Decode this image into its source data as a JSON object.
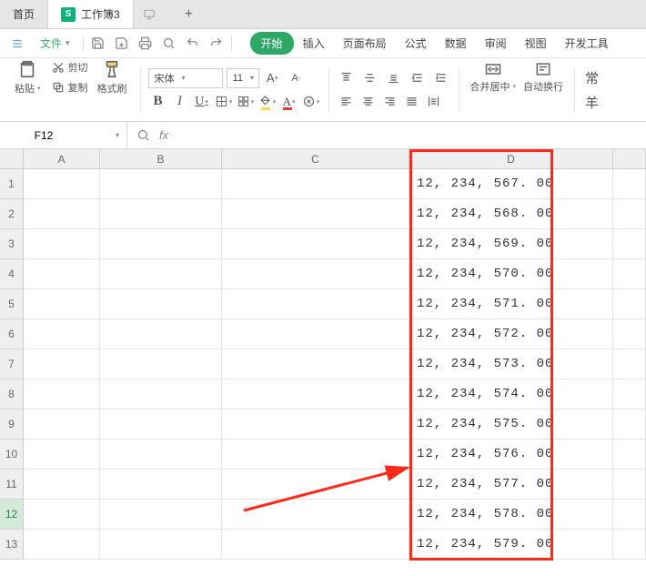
{
  "tabs": {
    "home_label": "首页",
    "workbook_label": "工作簿3",
    "add_title": "新建"
  },
  "menu": {
    "file_label": "文件",
    "ribbon": [
      "开始",
      "插入",
      "页面布局",
      "公式",
      "数据",
      "审阅",
      "视图",
      "开发工具"
    ],
    "active_index": 0
  },
  "clipboard": {
    "paste_label": "粘贴",
    "cut_label": "剪切",
    "copy_label": "复制",
    "format_painter_label": "格式刷"
  },
  "font": {
    "name": "宋体",
    "size": "11",
    "inc_title": "增大字号",
    "dec_title": "减小字号"
  },
  "alignment": {
    "merge_label": "合并居中",
    "wrap_label": "自动换行"
  },
  "currency": {
    "symbol": "常"
  },
  "yuan": {
    "symbol": "羊"
  },
  "name_box": {
    "value": "F12"
  },
  "formula": {
    "fx_label": "fx",
    "value": ""
  },
  "grid": {
    "columns": [
      "A",
      "B",
      "C",
      "D"
    ],
    "rows": [
      {
        "n": 1,
        "d": "12, 234, 567. 00"
      },
      {
        "n": 2,
        "d": "12, 234, 568. 00"
      },
      {
        "n": 3,
        "d": "12, 234, 569. 00"
      },
      {
        "n": 4,
        "d": "12, 234, 570. 00"
      },
      {
        "n": 5,
        "d": "12, 234, 571. 00"
      },
      {
        "n": 6,
        "d": "12, 234, 572. 00"
      },
      {
        "n": 7,
        "d": "12, 234, 573. 00"
      },
      {
        "n": 8,
        "d": "12, 234, 574. 00"
      },
      {
        "n": 9,
        "d": "12, 234, 575. 00"
      },
      {
        "n": 10,
        "d": "12, 234, 576. 00"
      },
      {
        "n": 11,
        "d": "12, 234, 577. 00"
      },
      {
        "n": 12,
        "d": "12, 234, 578. 00"
      },
      {
        "n": 13,
        "d": "12, 234, 579. 00"
      }
    ]
  }
}
